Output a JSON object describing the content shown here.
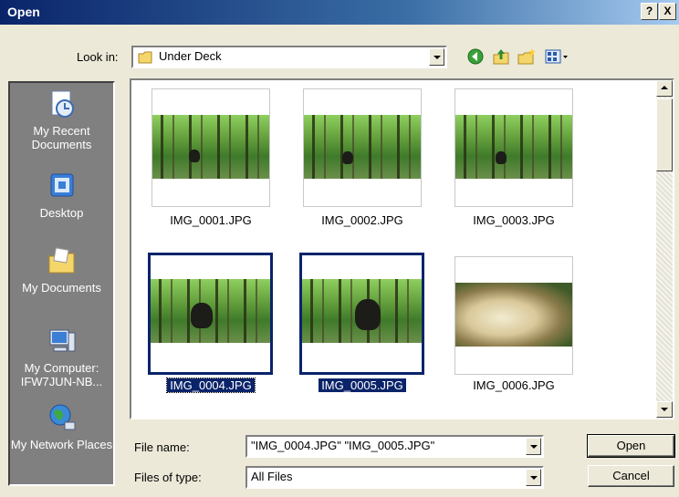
{
  "window": {
    "title": "Open",
    "help": "?",
    "close": "X"
  },
  "look_in": {
    "label": "Look in:",
    "value": "Under Deck",
    "icon": "folder-icon"
  },
  "toolbar": {
    "icons": [
      "back-icon",
      "up-folder-icon",
      "new-folder-icon",
      "views-menu-icon"
    ]
  },
  "places": [
    {
      "label": "My Recent Documents",
      "icon": "recent-documents-icon"
    },
    {
      "label": "Desktop",
      "icon": "desktop-icon"
    },
    {
      "label": "My Documents",
      "icon": "my-documents-icon"
    },
    {
      "label": "My Computer: IFW7JUN-NB...",
      "icon": "my-computer-icon"
    },
    {
      "label": "My Network Places",
      "icon": "network-places-icon"
    }
  ],
  "files": [
    {
      "name": "IMG_0001.JPG",
      "selected": false
    },
    {
      "name": "IMG_0002.JPG",
      "selected": false
    },
    {
      "name": "IMG_0003.JPG",
      "selected": false
    },
    {
      "name": "IMG_0004.JPG",
      "selected": true
    },
    {
      "name": "IMG_0005.JPG",
      "selected": true
    },
    {
      "name": "IMG_0006.JPG",
      "selected": false
    }
  ],
  "file_name": {
    "label": "File name:",
    "value": "\"IMG_0004.JPG\" \"IMG_0005.JPG\""
  },
  "file_type": {
    "label": "Files of type:",
    "value": "All Files"
  },
  "buttons": {
    "open": "Open",
    "cancel": "Cancel"
  },
  "colors": {
    "selection": "#0a246a",
    "dialog_bg": "#ece9d8",
    "places_bg": "#808080"
  }
}
